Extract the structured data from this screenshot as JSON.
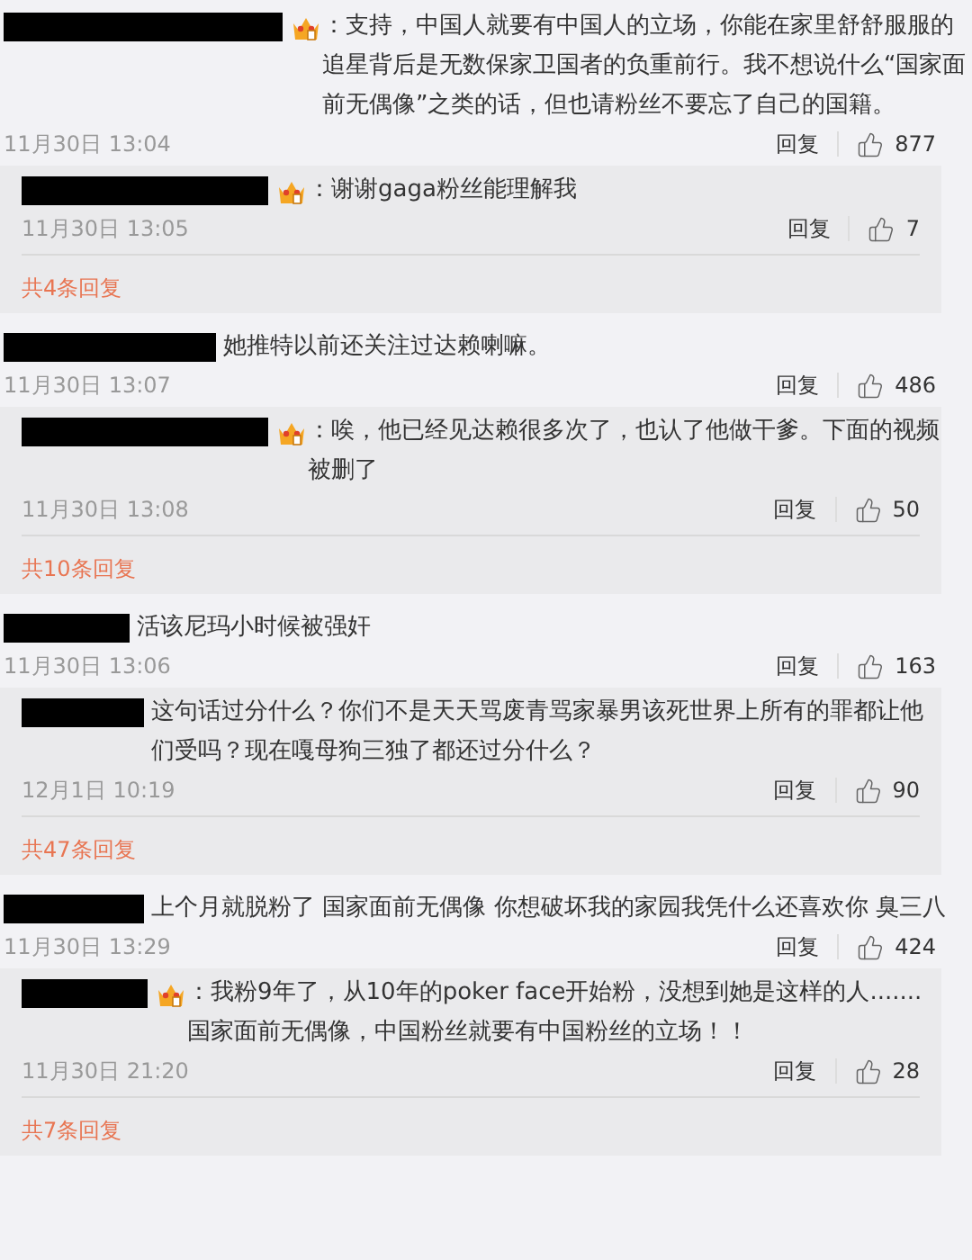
{
  "threads": [
    {
      "comment": {
        "has_badge": true,
        "text": "：支持，中国人就要有中国人的立场，你能在家里舒舒服服的追星背后是无数保家卫国者的负重前行。我不想说什么“国家面前无偶像”之类的话，但也请粉丝不要忘了自己的国籍。",
        "time": "11月30日 13:04",
        "reply_label": "回复",
        "likes": "877"
      },
      "reply": {
        "has_badge": true,
        "text": "：谢谢gaga粉丝能理解我",
        "time": "11月30日 13:05",
        "reply_label": "回复",
        "likes": "7"
      },
      "more_replies": "共4条回复"
    },
    {
      "comment": {
        "has_badge": false,
        "text": "她推特以前还关注过达赖喇嘛。",
        "time": "11月30日 13:07",
        "reply_label": "回复",
        "likes": "486"
      },
      "reply": {
        "has_badge": true,
        "text": "：唉，他已经见达赖很多次了，也认了他做干爹。下面的视频被删了",
        "time": "11月30日 13:08",
        "reply_label": "回复",
        "likes": "50"
      },
      "more_replies": "共10条回复"
    },
    {
      "comment": {
        "has_badge": false,
        "text": "活该尼玛小时候被强奸",
        "time": "11月30日 13:06",
        "reply_label": "回复",
        "likes": "163"
      },
      "reply": {
        "has_badge": false,
        "text": "这句话过分什么？你们不是天天骂废青骂家暴男该死世界上所有的罪都让他们受吗？现在嘎母狗三独了都还过分什么？",
        "time": "12月1日 10:19",
        "reply_label": "回复",
        "likes": "90"
      },
      "more_replies": "共47条回复"
    },
    {
      "comment": {
        "has_badge": false,
        "text": "上个月就脱粉了 国家面前无偶像 你想破坏我的家园我凭什么还喜欢你 臭三八",
        "time": "11月30日 13:29",
        "reply_label": "回复",
        "likes": "424"
      },
      "reply": {
        "has_badge": true,
        "text": "：我粉9年了，从10年的poker face开始粉，没想到她是这样的人.......国家面前无偶像，中国粉丝就要有中国粉丝的立场！！",
        "time": "11月30日 21:20",
        "reply_label": "回复",
        "likes": "28"
      },
      "more_replies": "共7条回复"
    }
  ]
}
